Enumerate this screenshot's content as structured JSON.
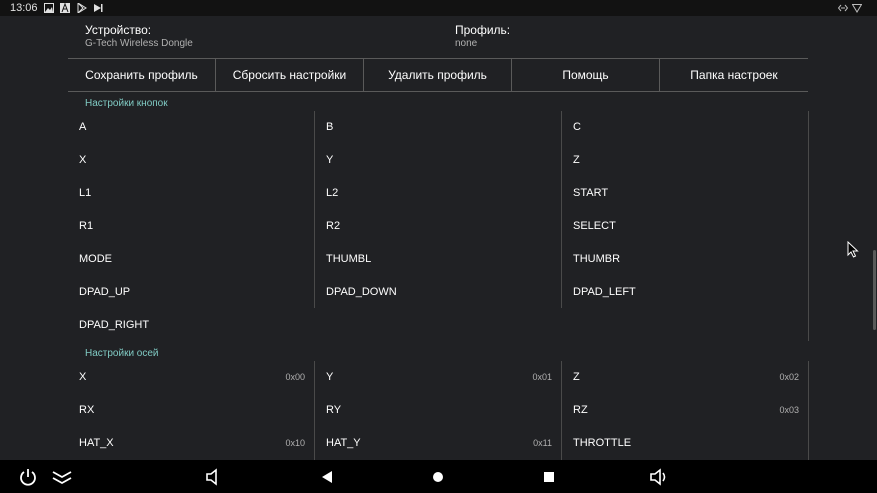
{
  "status_bar": {
    "time": "13:06",
    "icons": [
      "image-icon",
      "notification-a-icon",
      "play-store-icon",
      "media-play-icon"
    ],
    "right_icons": [
      "code-arrows-icon",
      "wifi-icon"
    ]
  },
  "header": {
    "device_label": "Устройство:",
    "device_value": "G-Tech Wireless Dongle",
    "profile_label": "Профиль:",
    "profile_value": "none"
  },
  "toolbar": {
    "save": "Сохранить профиль",
    "reset": "Сбросить настройки",
    "delete": "Удалить профиль",
    "help": "Помощь",
    "folder": "Папка настроек"
  },
  "buttons_section": {
    "title": "Настройки кнопок",
    "items": [
      "A",
      "B",
      "C",
      "X",
      "Y",
      "Z",
      "L1",
      "L2",
      "START",
      "R1",
      "R2",
      "SELECT",
      "MODE",
      "THUMBL",
      "THUMBR",
      "DPAD_UP",
      "DPAD_DOWN",
      "DPAD_LEFT",
      "DPAD_RIGHT"
    ]
  },
  "axes_section": {
    "title": "Настройки осей",
    "items": [
      {
        "label": "X",
        "code": "0x00"
      },
      {
        "label": "Y",
        "code": "0x01"
      },
      {
        "label": "Z",
        "code": "0x02"
      },
      {
        "label": "RX",
        "code": ""
      },
      {
        "label": "RY",
        "code": ""
      },
      {
        "label": "RZ",
        "code": "0x03"
      },
      {
        "label": "HAT_X",
        "code": "0x10"
      },
      {
        "label": "HAT_Y",
        "code": "0x11"
      },
      {
        "label": "THROTTLE",
        "code": ""
      }
    ]
  },
  "nav_bar": {
    "icons": [
      "power-icon",
      "chevrons-down-icon",
      "volume-down-icon",
      "back-icon",
      "home-icon",
      "recents-icon",
      "volume-up-icon"
    ]
  },
  "colors": {
    "background": "#202124",
    "accent": "#80cbc4",
    "divider": "#5a5a5a"
  }
}
